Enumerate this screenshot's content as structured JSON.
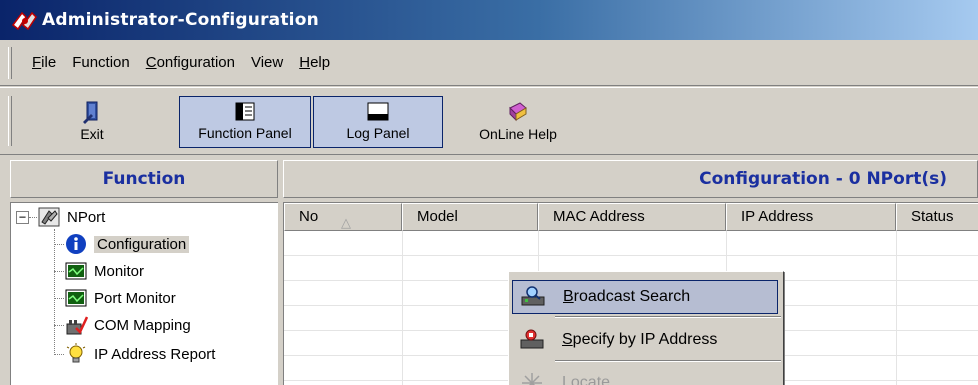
{
  "window": {
    "title": "Administrator-Configuration"
  },
  "menubar": {
    "items": [
      {
        "label": "File",
        "mnemonic": "F",
        "rest": "ile"
      },
      {
        "label": "Function",
        "mnemonic": "",
        "rest": "Function"
      },
      {
        "label": "Configuration",
        "mnemonic": "C",
        "rest": "onfiguration"
      },
      {
        "label": "View",
        "mnemonic": "",
        "rest": "View"
      },
      {
        "label": "Help",
        "mnemonic": "H",
        "rest": "elp"
      }
    ]
  },
  "toolbar": {
    "exit_label": "Exit",
    "function_panel_label": "Function Panel",
    "log_panel_label": "Log Panel",
    "online_help_label": "OnLine Help"
  },
  "left_panel": {
    "header": "Function",
    "tree": {
      "expander": "−",
      "root_label": "NPort",
      "items": [
        {
          "label": "Configuration",
          "icon": "info-icon"
        },
        {
          "label": "Monitor",
          "icon": "monitor-icon"
        },
        {
          "label": "Port Monitor",
          "icon": "port-monitor-icon"
        },
        {
          "label": "COM Mapping",
          "icon": "com-mapping-icon"
        },
        {
          "label": "IP Address Report",
          "icon": "ip-report-icon"
        }
      ]
    }
  },
  "right_panel": {
    "header": "Configuration - 0 NPort(s)",
    "columns": [
      "No",
      "Model",
      "MAC Address",
      "IP Address",
      "Status"
    ],
    "sort_indicator": "△"
  },
  "context_menu": {
    "items": [
      {
        "label": "Broadcast Search",
        "mnemonic": "B",
        "rest": "roadcast Search",
        "state": "highlighted",
        "icon": "broadcast-search-icon"
      },
      {
        "label": "Specify by IP Address",
        "mnemonic": "S",
        "rest": "pecify by IP Address",
        "state": "normal",
        "icon": "specify-ip-icon"
      },
      {
        "label": "Locate",
        "mnemonic": "L",
        "rest": "ocate",
        "state": "disabled",
        "icon": "locate-icon"
      }
    ]
  },
  "colors": {
    "titlebar_start": "#0a246a",
    "titlebar_end": "#a6caf0",
    "header_text": "#1a2fa0",
    "face": "#d4d0c8",
    "selection": "#b6bdd2"
  }
}
